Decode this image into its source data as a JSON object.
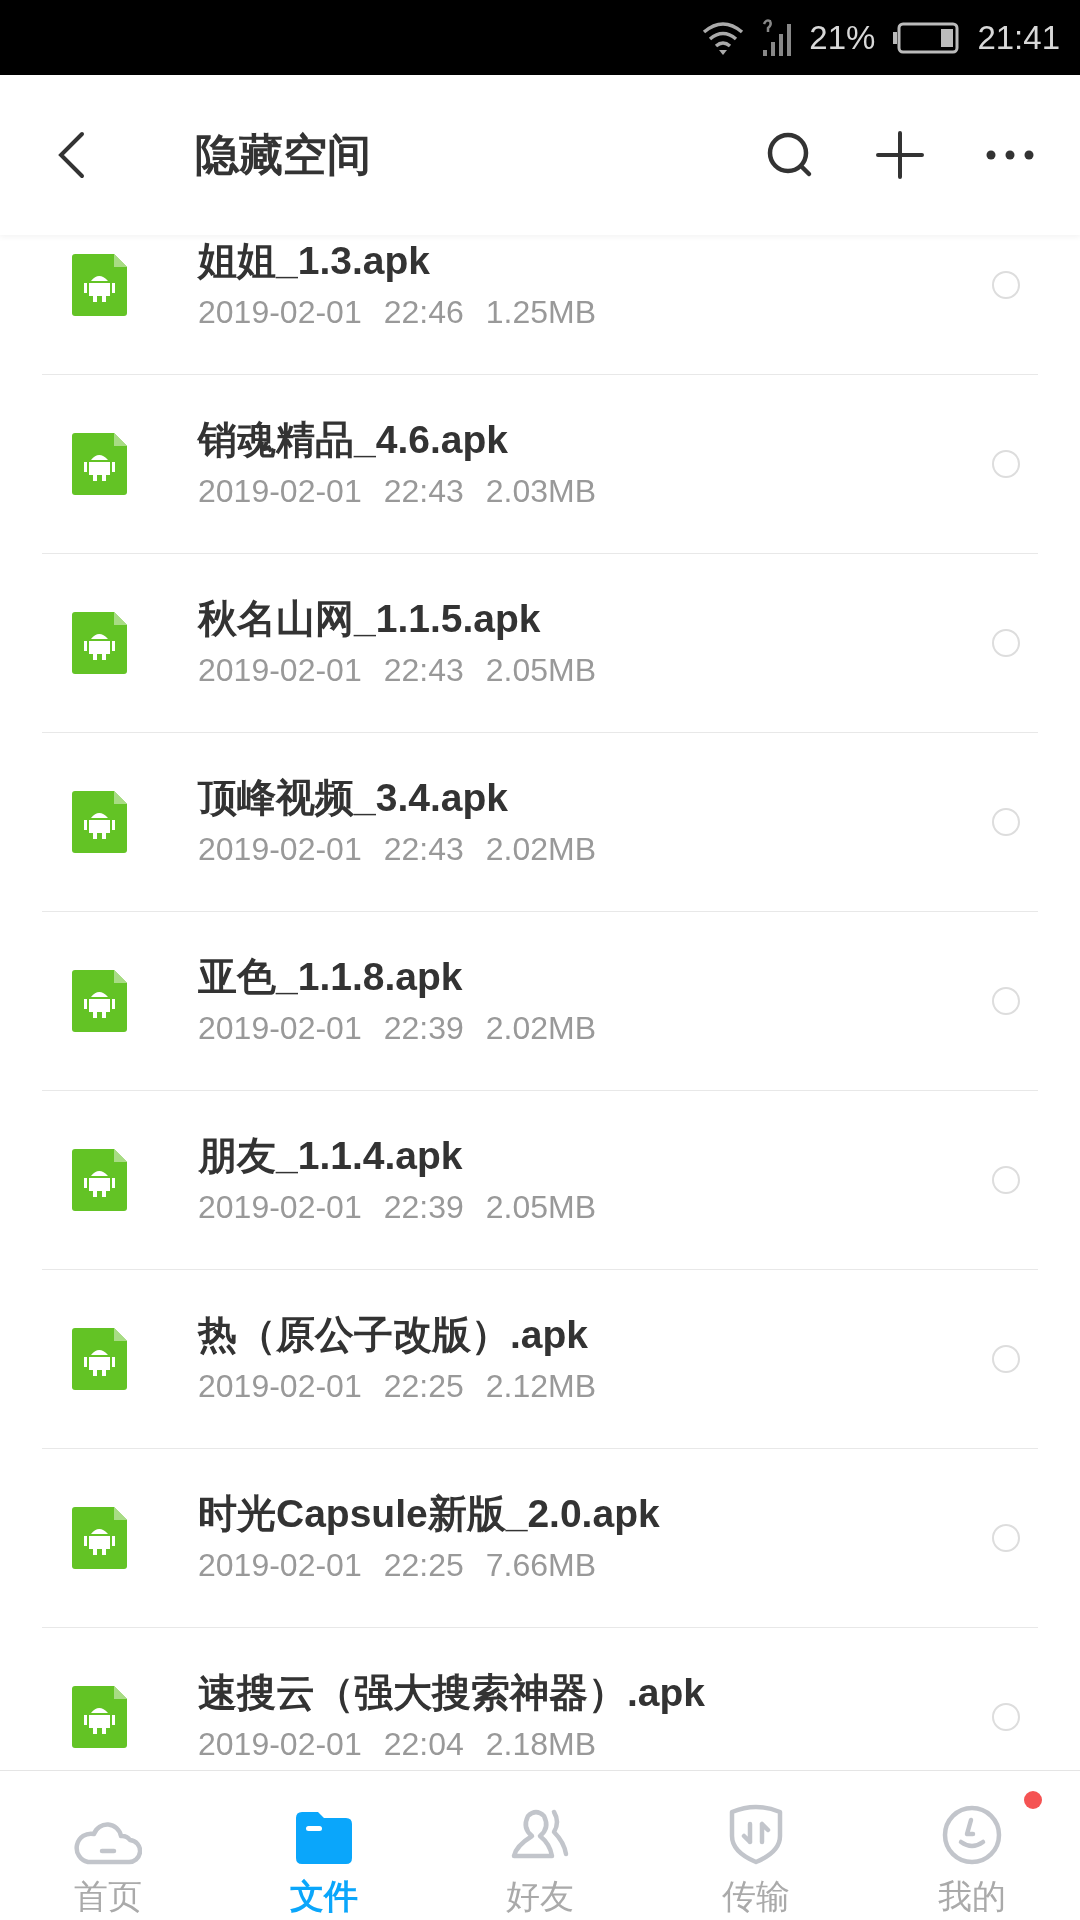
{
  "status_bar": {
    "battery": "21%",
    "time": "21:41"
  },
  "header": {
    "title": "隐藏空间"
  },
  "files": [
    {
      "name": "姐姐_1.3.apk",
      "date": "2019-02-01",
      "time": "22:46",
      "size": "1.25MB",
      "selected": false
    },
    {
      "name": "销魂精品_4.6.apk",
      "date": "2019-02-01",
      "time": "22:43",
      "size": "2.03MB",
      "selected": false
    },
    {
      "name": "秋名山网_1.1.5.apk",
      "date": "2019-02-01",
      "time": "22:43",
      "size": "2.05MB",
      "selected": false
    },
    {
      "name": "顶峰视频_3.4.apk",
      "date": "2019-02-01",
      "time": "22:43",
      "size": "2.02MB",
      "selected": false
    },
    {
      "name": "亚色_1.1.8.apk",
      "date": "2019-02-01",
      "time": "22:39",
      "size": "2.02MB",
      "selected": false
    },
    {
      "name": "朋友_1.1.4.apk",
      "date": "2019-02-01",
      "time": "22:39",
      "size": "2.05MB",
      "selected": false
    },
    {
      "name": "热（原公子改版）.apk",
      "date": "2019-02-01",
      "time": "22:25",
      "size": "2.12MB",
      "selected": false
    },
    {
      "name": "时光Capsule新版_2.0.apk",
      "date": "2019-02-01",
      "time": "22:25",
      "size": "7.66MB",
      "selected": false
    },
    {
      "name": "速搜云（强大搜索神器）.apk",
      "date": "2019-02-01",
      "time": "22:04",
      "size": "2.18MB",
      "selected": false
    }
  ],
  "tabs": [
    {
      "kind": "home",
      "label": "首页",
      "selected": false,
      "badge": false
    },
    {
      "kind": "files",
      "label": "文件",
      "selected": true,
      "badge": false
    },
    {
      "kind": "friends",
      "label": "好友",
      "selected": false,
      "badge": false
    },
    {
      "kind": "transfer",
      "label": "传输",
      "selected": false,
      "badge": false
    },
    {
      "kind": "me",
      "label": "我的",
      "selected": false,
      "badge": true
    }
  ]
}
